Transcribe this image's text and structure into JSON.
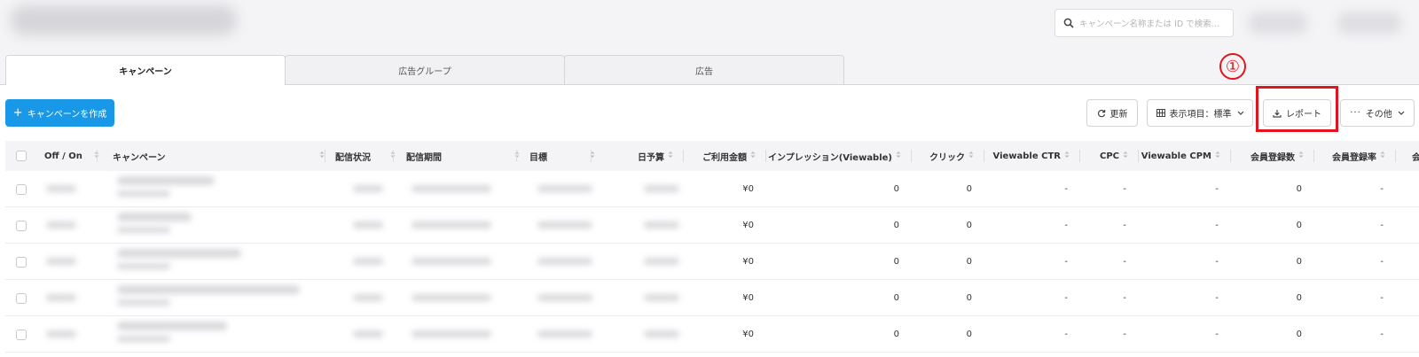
{
  "search": {
    "placeholder": "キャンペーン名称または ID で検索..."
  },
  "tabs": [
    {
      "label": "キャンペーン"
    },
    {
      "label": "広告グループ"
    },
    {
      "label": "広告"
    }
  ],
  "toolbar": {
    "create_label": "キャンペーンを作成",
    "refresh_label": "更新",
    "columns_label": "表示項目：標準",
    "report_label": "レポート",
    "more_label": "その他"
  },
  "annotation": {
    "marker": "①"
  },
  "table": {
    "columns": [
      "Off / On",
      "キャンペーン",
      "配信状況",
      "配信期間",
      "目標",
      "日予算",
      "ご利用金額",
      "インプレッション(Viewable)",
      "クリック",
      "Viewable CTR",
      "CPC",
      "Viewable CPM",
      "会員登録数",
      "会員登録率"
    ],
    "rows": [
      {
        "spend": "¥0",
        "impressions": "0",
        "clicks": "0",
        "ctr": "-",
        "cpc": "-",
        "cpm": "-",
        "signups": "0",
        "signup_rate": "-"
      },
      {
        "spend": "¥0",
        "impressions": "0",
        "clicks": "0",
        "ctr": "-",
        "cpc": "-",
        "cpm": "-",
        "signups": "0",
        "signup_rate": "-"
      },
      {
        "spend": "¥0",
        "impressions": "0",
        "clicks": "0",
        "ctr": "-",
        "cpc": "-",
        "cpm": "-",
        "signups": "0",
        "signup_rate": "-"
      },
      {
        "spend": "¥0",
        "impressions": "0",
        "clicks": "0",
        "ctr": "-",
        "cpc": "-",
        "cpm": "-",
        "signups": "0",
        "signup_rate": "-"
      },
      {
        "spend": "¥0",
        "impressions": "0",
        "clicks": "0",
        "ctr": "-",
        "cpc": "-",
        "cpm": "-",
        "signups": "0",
        "signup_rate": "-"
      }
    ]
  },
  "colors": {
    "primary": "#1a98e8",
    "highlight": "#e0161e"
  }
}
